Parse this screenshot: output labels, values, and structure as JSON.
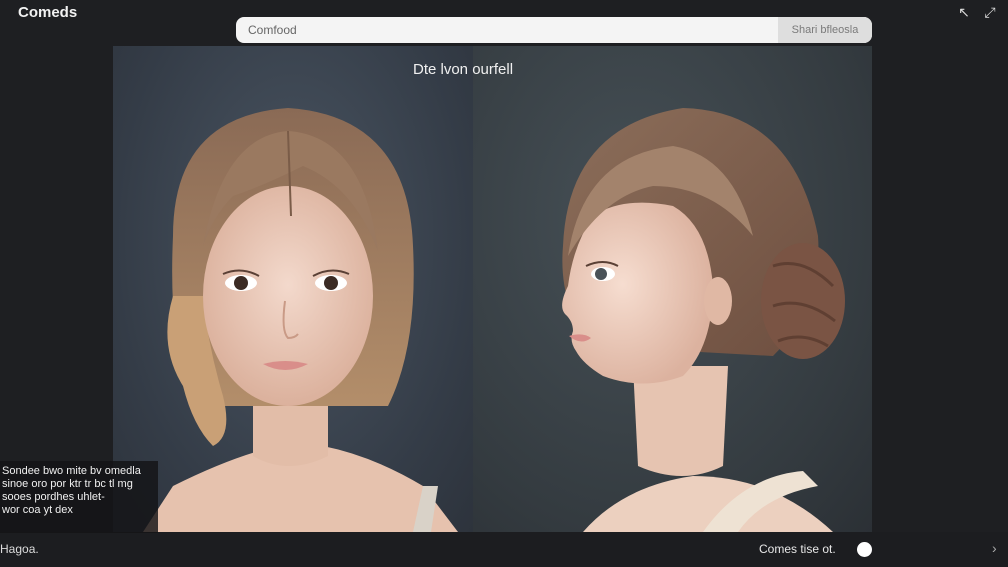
{
  "app": {
    "title": "Comeds"
  },
  "search": {
    "value": "Comfood",
    "button_label": "Shari bfleosla"
  },
  "header_icons": [
    {
      "name": "undo-icon",
      "glyph": "↖"
    },
    {
      "name": "expand-icon",
      "glyph": "⤢"
    }
  ],
  "stage": {
    "caption": "Dte lvon ourfell"
  },
  "overlay": {
    "lines": [
      "Sondee bwo mite bv omedla",
      "sinoe oro por ktr tr bc tl mg",
      "sooes pordhes uhlet-",
      "wor coa yt dex"
    ]
  },
  "footer": {
    "left_label": "Hagoa.",
    "status_label": "Comes tise ot."
  },
  "colors": {
    "background": "#1e1f22",
    "search_bg": "#f4f4f4",
    "accent": "#ffffff"
  }
}
